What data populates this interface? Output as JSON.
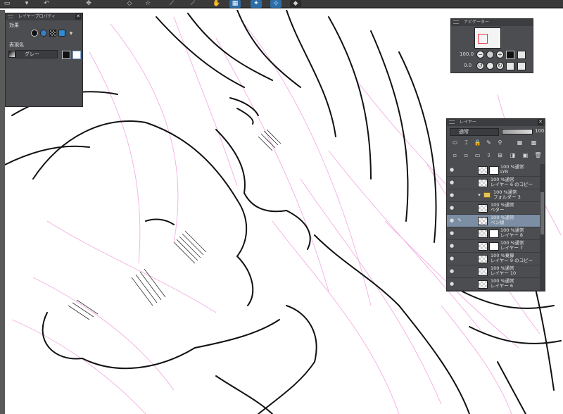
{
  "window": {
    "accent": "#2c6ea8",
    "panel_bg": "#4b4d50"
  },
  "layer_property": {
    "title": "レイヤープロパティ",
    "effect_label": "効果",
    "expression_color_label": "表現色",
    "expression_color_value": "グレー"
  },
  "navigator": {
    "title": "ナビゲーター",
    "zoom": "100.0",
    "rotation": "0.0"
  },
  "layers": {
    "title": "レイヤー",
    "blend_mode": "通常",
    "opacity": "100",
    "items": [
      {
        "mode": "100 %通常",
        "name": "LYR",
        "selected": false
      },
      {
        "mode": "100 %通常",
        "name": "レイヤー 6 のコピー",
        "selected": false
      },
      {
        "mode": "100 %通常",
        "name": "フォルダー 3",
        "selected": false,
        "folder": true
      },
      {
        "mode": "100 %通常",
        "name": "ベター",
        "selected": false
      },
      {
        "mode": "100 %通常",
        "name": "ペン線",
        "selected": true
      },
      {
        "mode": "100 %通常",
        "name": "レイヤー 8",
        "selected": false
      },
      {
        "mode": "100 %通常",
        "name": "レイヤー 7",
        "selected": false
      },
      {
        "mode": "100 %乗算",
        "name": "レイヤー 9 のコピー",
        "selected": false
      },
      {
        "mode": "100 %通常",
        "name": "レイヤー 10",
        "selected": false
      },
      {
        "mode": "100 %通常",
        "name": "レイヤー 6",
        "selected": false
      }
    ]
  },
  "icons": {
    "close": "close-icon",
    "eye": "eye-icon",
    "folder": "folder-icon",
    "pen": "pen-icon"
  }
}
